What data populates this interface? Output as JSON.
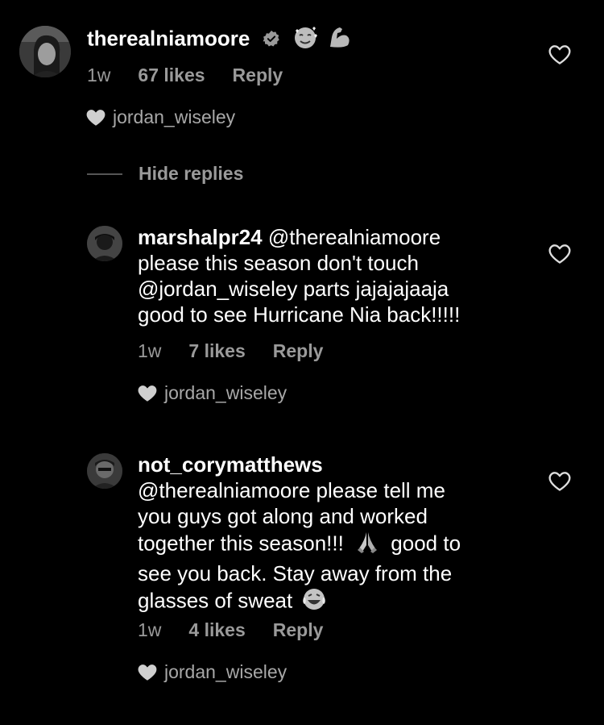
{
  "main_comment": {
    "username": "therealniamoore",
    "verified": true,
    "emojis": [
      "smiling-face-with-hearts-emoji",
      "flexed-biceps-emoji"
    ],
    "time": "1w",
    "likes": "67 likes",
    "reply": "Reply",
    "liked_by": "jordan_wiseley"
  },
  "hide_replies": "Hide replies",
  "replies": [
    {
      "username": "marshalpr24",
      "mention": "@therealniamoore",
      "line1_rest": "please this season don't touch",
      "line2": "@jordan_wiseley  parts jajajajaaja",
      "line3": "good to see Hurricane Nia back!!!!!",
      "time": "1w",
      "likes": "7 likes",
      "reply": "Reply",
      "liked_by": "jordan_wiseley"
    },
    {
      "username": "not_corymatthews",
      "line1": "@therealniamoore please tell me",
      "line2": "you guys got along and worked",
      "line3a": "together this season!!!",
      "line3b": "good to",
      "line4": "see you back. Stay away from the",
      "line5": "glasses of sweat",
      "emojis": [
        "folded-hands-emoji",
        "tears-of-joy-emoji"
      ],
      "time": "1w",
      "likes": "4 likes",
      "reply": "Reply",
      "liked_by": "jordan_wiseley"
    }
  ],
  "colors": {
    "background": "#000000",
    "text": "#ffffff",
    "secondary": "#9a9a9a"
  }
}
